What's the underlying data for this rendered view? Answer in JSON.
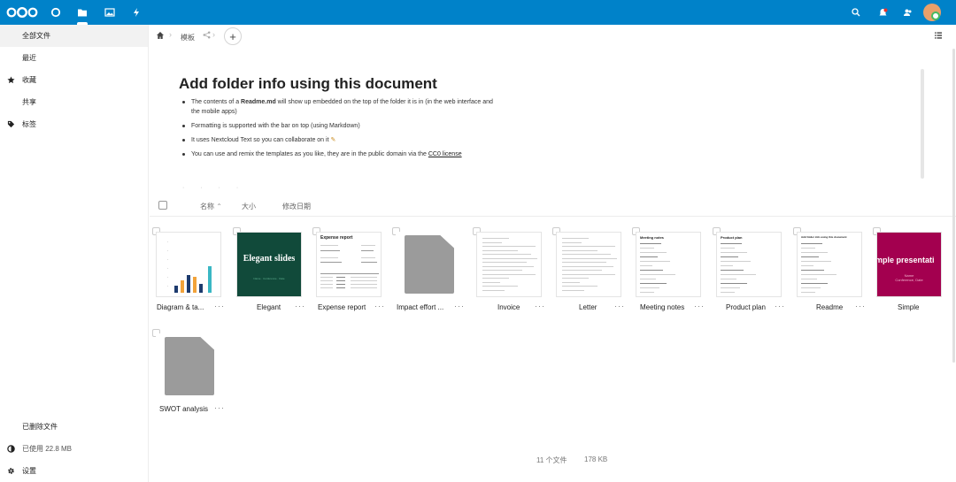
{
  "header": {
    "apps": [
      "files-icon",
      "activity-icon",
      "photos-icon",
      "lightning-icon"
    ],
    "right_icons": [
      "search-icon",
      "notifications-icon",
      "contacts-icon"
    ],
    "brand_color": "#0082c9"
  },
  "sidebar": {
    "items": [
      {
        "label": "全部文件",
        "icon": ""
      },
      {
        "label": "最近",
        "icon": ""
      },
      {
        "label": "收藏",
        "icon": "star-icon"
      },
      {
        "label": "共享",
        "icon": ""
      },
      {
        "label": "标签",
        "icon": "tag-icon"
      }
    ],
    "bottom": {
      "deleted": "已删除文件",
      "quota": "已使用 22.8 MB",
      "settings": "设置"
    }
  },
  "breadcrumb": {
    "folder": "模板"
  },
  "readme": {
    "title": "Add folder info using this document",
    "items": [
      {
        "pre": "The contents of a ",
        "bold": "Readme.md",
        "post": " will show up embedded on the top of the folder it is in (in the web interface and the mobile apps)"
      },
      {
        "pre": "Formatting is supported with the bar on top (using Markdown)",
        "bold": "",
        "post": ""
      },
      {
        "pre": "It uses Nextcloud Text so you can collaborate on it ",
        "bold": "",
        "post": ""
      },
      {
        "pre": "You can use and remix the templates as you like, they are in the public domain via the ",
        "bold": "",
        "post": "",
        "link": "CC0 license"
      }
    ]
  },
  "list_header": {
    "name": "名称",
    "size": "大小",
    "modified": "修改日期"
  },
  "files": [
    {
      "name": "Diagram & ta...",
      "thumb": "chart"
    },
    {
      "name": "Elegant",
      "thumb": "elegant",
      "thumb_text": "Elegant slides",
      "thumb_sub": "Name · Conference · Date"
    },
    {
      "name": "Expense report",
      "thumb": "expense",
      "thumb_text": "Expense report"
    },
    {
      "name": "Impact effort ...",
      "thumb": "generic"
    },
    {
      "name": "Invoice",
      "thumb": "doc"
    },
    {
      "name": "Letter",
      "thumb": "doc"
    },
    {
      "name": "Meeting notes",
      "thumb": "notes",
      "thumb_text": "Meeting notes"
    },
    {
      "name": "Product plan",
      "thumb": "notes",
      "thumb_text": "Product plan"
    },
    {
      "name": "Readme",
      "thumb": "notes",
      "thumb_text": "Add folder info using this document"
    },
    {
      "name": "Simple",
      "thumb": "simple",
      "thumb_text": "mple presentati",
      "thumb_sub": "Name\nConference, Date"
    },
    {
      "name": "SWOT analysis",
      "thumb": "generic"
    }
  ],
  "more_label": "···",
  "summary": {
    "count": "11 个文件",
    "size": "178 KB"
  }
}
